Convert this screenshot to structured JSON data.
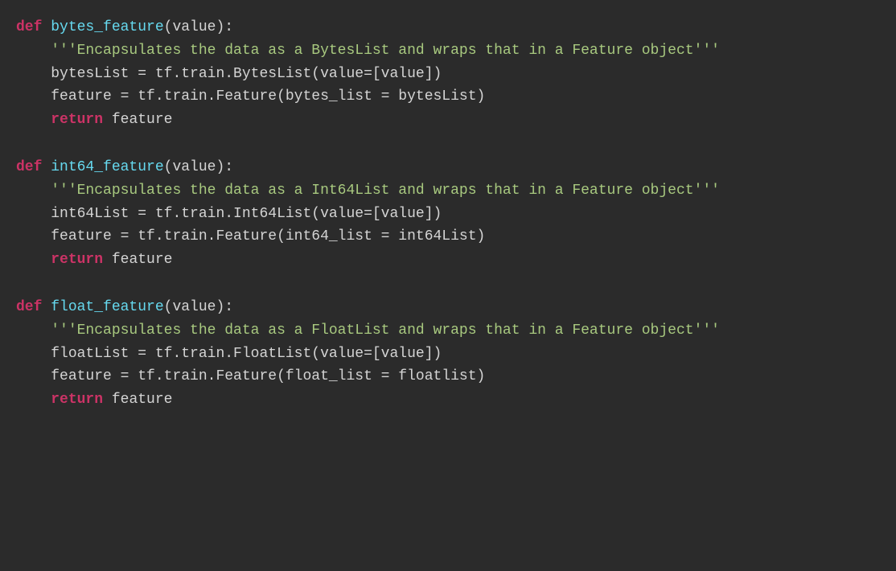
{
  "background": "#2b2b2b",
  "functions": [
    {
      "id": "bytes_feature",
      "def_line": "def bytes_feature(value):",
      "def_keyword": "def",
      "def_name": "bytes_feature",
      "def_params": "(value):",
      "docstring": "'''Encapsulates the data as a BytesList and wraps that in a Feature object'''",
      "lines": [
        "bytesList = tf.train.BytesList(value=[value])",
        "feature = tf.train.Feature(bytes_list = bytesList)",
        "return feature"
      ],
      "return_keyword": "return",
      "return_var": "feature"
    },
    {
      "id": "int64_feature",
      "def_line": "def int64_feature(value):",
      "def_keyword": "def",
      "def_name": "int64_feature",
      "def_params": "(value):",
      "docstring": "'''Encapsulates the data as a Int64List and wraps that in a Feature object'''",
      "lines": [
        "int64List = tf.train.Int64List(value=[value])",
        "feature = tf.train.Feature(int64_list = int64List)",
        "return feature"
      ],
      "return_keyword": "return",
      "return_var": "feature"
    },
    {
      "id": "float_feature",
      "def_line": "def float_feature(value):",
      "def_keyword": "def",
      "def_name": "float_feature",
      "def_params": "(value):",
      "docstring": "'''Encapsulates the data as a FloatList and wraps that in a Feature object'''",
      "lines": [
        "floatList = tf.train.FloatList(value=[value])",
        "feature = tf.train.Feature(float_list = floatlist)",
        "return feature"
      ],
      "return_keyword": "return",
      "return_var": "feature"
    }
  ]
}
